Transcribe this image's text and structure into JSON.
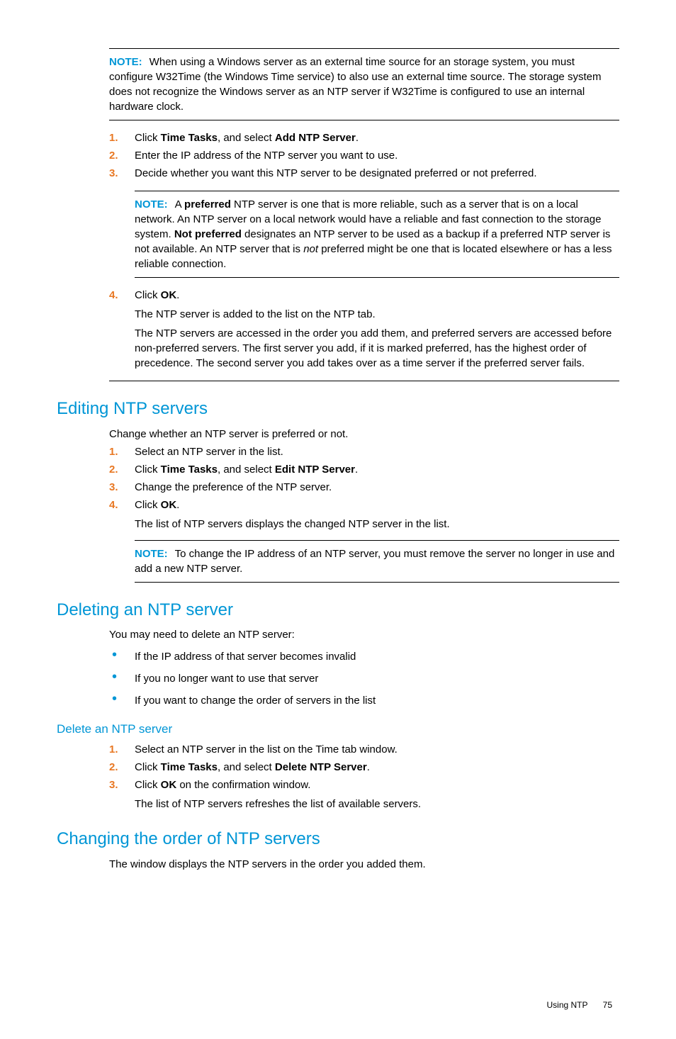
{
  "note1": {
    "label": "NOTE:",
    "text": "When using a Windows server as an external time source for an storage system, you must configure W32Time (the Windows Time service) to also use an external time source. The storage system does not recognize the Windows server as an NTP server if W32Time is configured to use an internal hardware clock."
  },
  "steps_a": {
    "s1_pre": "Click ",
    "s1_b1": "Time Tasks",
    "s1_mid": ", and select ",
    "s1_b2": "Add NTP Server",
    "s1_post": ".",
    "s2": "Enter the IP address of the NTP server you want to use.",
    "s3": "Decide whether you want this NTP server to be designated preferred or not preferred."
  },
  "note2": {
    "label": "NOTE:",
    "t1": "A ",
    "b1": "preferred",
    "t2": " NTP server is one that is more reliable, such as a server that is on a local network. An NTP server on a local network would have a reliable and fast connection to the storage system. ",
    "b2": "Not preferred",
    "t3": " designates an NTP server to be used as a backup if a preferred NTP server is not available. An NTP server that is ",
    "i1": "not",
    "t4": " preferred might be one that is located elsewhere or has a less reliable connection."
  },
  "steps_a4": {
    "s4_pre": "Click ",
    "s4_b": "OK",
    "s4_post": ".",
    "sub1": "The NTP server is added to the list on the NTP tab.",
    "sub2": "The NTP servers are accessed in the order you add them, and preferred servers are accessed before non-preferred servers. The first server you add, if it is marked preferred, has the highest order of precedence. The second server you add takes over as a time server if the preferred server fails."
  },
  "editing": {
    "heading": "Editing NTP servers",
    "intro": "Change whether an NTP server is preferred or not.",
    "s1": "Select an NTP server in the list.",
    "s2_pre": "Click ",
    "s2_b1": "Time Tasks",
    "s2_mid": ", and select ",
    "s2_b2": "Edit NTP Server",
    "s2_post": ".",
    "s3": "Change the preference of the NTP server.",
    "s4_pre": "Click ",
    "s4_b": "OK",
    "s4_post": ".",
    "sub": "The list of NTP servers displays the changed NTP server in the list."
  },
  "note3": {
    "label": "NOTE:",
    "text": "To change the IP address of an NTP server, you must remove the server no longer in use and add a new NTP server."
  },
  "deleting": {
    "heading": "Deleting an NTP server",
    "intro": "You may need to delete an NTP server:",
    "b1": "If the IP address of that server becomes invalid",
    "b2": "If you no longer want to use that server",
    "b3": "If you want to change the order of servers in the list"
  },
  "delete_sub": {
    "heading": "Delete an NTP server",
    "s1": "Select an NTP server in the list on the Time tab window.",
    "s2_pre": "Click ",
    "s2_b1": "Time Tasks",
    "s2_mid": ", and select ",
    "s2_b2": "Delete NTP Server",
    "s2_post": ".",
    "s3_pre": "Click ",
    "s3_b": "OK",
    "s3_post": " on the confirmation window.",
    "sub": "The list of NTP servers refreshes the list of available servers."
  },
  "changing": {
    "heading": "Changing the order of NTP servers",
    "text": "The window displays the NTP servers in the order you added them."
  },
  "footer": {
    "section": "Using NTP",
    "page": "75"
  }
}
